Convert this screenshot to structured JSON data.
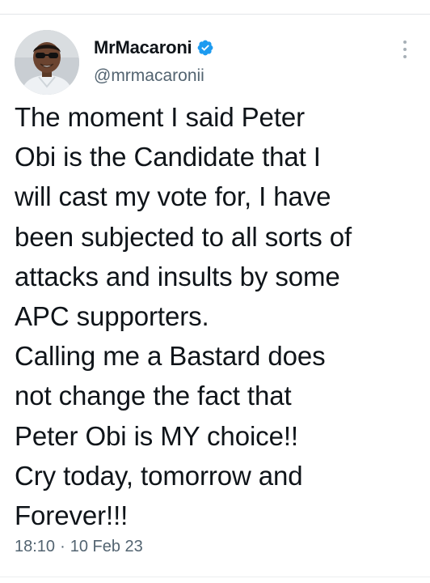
{
  "tweet": {
    "display_name": "MrMacaroni",
    "handle": "@mrmacaronii",
    "verified_icon": "verified-badge-icon",
    "verified_color": "#1d9bf0",
    "more_icon": "more-vertical-icon",
    "text": "The moment I said Peter\nObi is the Candidate that I\nwill cast my vote for, I have\nbeen subjected to all sorts of\nattacks and insults by some\nAPC supporters.\nCalling me a Bastard does\nnot change the fact that\nPeter Obi is MY choice!!\nCry today, tomorrow and\nForever!!!",
    "time": "18:10",
    "separator": "·",
    "date": "10 Feb 23"
  }
}
